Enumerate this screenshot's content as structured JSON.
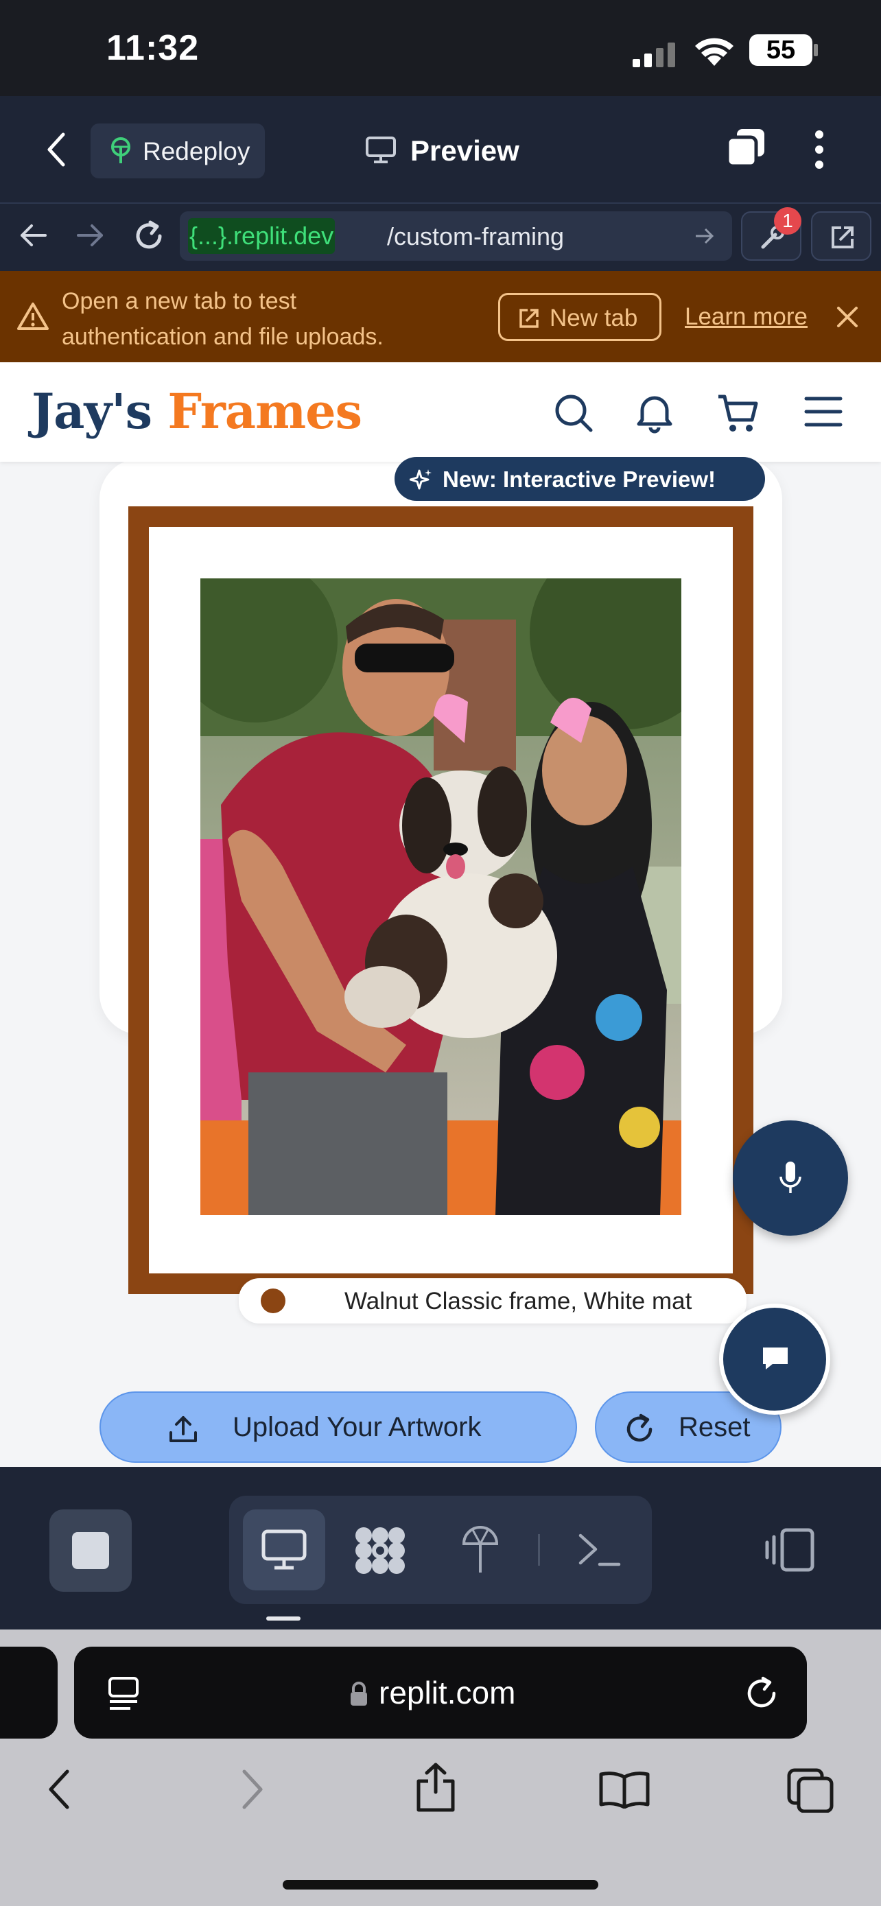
{
  "status_bar": {
    "time": "11:32",
    "battery": "55"
  },
  "replit_header": {
    "redeploy_label": "Redeploy",
    "preview_label": "Preview"
  },
  "url_bar": {
    "domain": "{...}.replit.dev",
    "path": "/custom-framing",
    "badge_count": "1"
  },
  "banner": {
    "line1": "Open a new tab to test",
    "line2": "authentication and file uploads.",
    "new_tab_label": "New tab",
    "learn_more_label": "Learn more"
  },
  "site": {
    "logo_part1": "Jay's",
    "logo_part2": "Frames",
    "new_badge": "New: Interactive Preview!",
    "frame_label": "Walnut Classic frame, White mat",
    "upload_button": "Upload Your Artwork",
    "reset_button": "Reset"
  },
  "safari": {
    "address": "replit.com"
  },
  "colors": {
    "navy": "#1e3a5f",
    "orange": "#f47920",
    "walnut": "#8b4513",
    "button_blue": "#8ab6f6",
    "banner_bg": "#6b3300",
    "replit_bg": "#1e2536"
  }
}
